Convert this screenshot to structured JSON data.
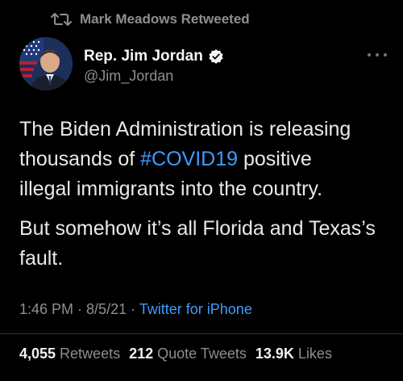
{
  "retweet_banner": {
    "label": "Mark Meadows Retweeted",
    "icon": "retweet-icon"
  },
  "author": {
    "name": "Rep. Jim Jordan",
    "handle": "@Jim_Jordan",
    "verified": true,
    "avatar_icon": "profile-avatar"
  },
  "menu": {
    "icon": "more-options-icon"
  },
  "tweet": {
    "line1_a": "The Biden Administration is releasing",
    "line2_a": "thousands of ",
    "hashtag": "#COVID19",
    "line2_b": " positive",
    "line3": "illegal immigrants into the country.",
    "para2": "But somehow it’s all Florida and Texas’s fault."
  },
  "meta": {
    "time": "1:46 PM",
    "sep1": " · ",
    "date": "8/5/21",
    "sep2": " · ",
    "source": "Twitter for iPhone"
  },
  "stats": {
    "retweets_count": "4,055",
    "retweets_label": "Retweets",
    "quotes_count": "212",
    "quotes_label": "Quote Tweets",
    "likes_count": "13.9K",
    "likes_label": "Likes"
  },
  "colors": {
    "background": "#000000",
    "text": "#e7e9ea",
    "secondary": "#8b8f94",
    "link": "#3f9bff",
    "verified_badge": "#f5f5f5"
  }
}
